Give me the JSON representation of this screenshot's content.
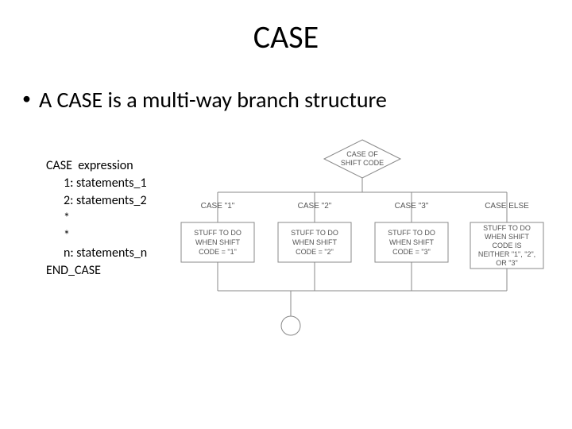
{
  "title": "CASE",
  "bullet": "A CASE is a multi-way branch structure",
  "code": {
    "l1": "CASE  expression",
    "l2": "1: statements_1",
    "l3": "2: statements_2",
    "l4": "*",
    "l5": "*",
    "l6": "n: statements_n",
    "l7": "END_CASE"
  },
  "diagram": {
    "decision": {
      "line1": "CASE OF",
      "line2": "SHIFT CODE"
    },
    "branches": {
      "b1": "CASE \"1\"",
      "b2": "CASE \"2\"",
      "b3": "CASE \"3\"",
      "b4": "CASE ELSE"
    },
    "boxes": {
      "bx1": {
        "l1": "STUFF TO DO",
        "l2": "WHEN SHIFT",
        "l3": "CODE = \"1\""
      },
      "bx2": {
        "l1": "STUFF TO DO",
        "l2": "WHEN SHIFT",
        "l3": "CODE = \"2\""
      },
      "bx3": {
        "l1": "STUFF TO DO",
        "l2": "WHEN SHIFT",
        "l3": "CODE = \"3\""
      },
      "bx4": {
        "l1": "STUFF TO DO",
        "l2": "WHEN SHIFT",
        "l3": "CODE IS",
        "l4": "NEITHER \"1\", \"2\",",
        "l5": "OR \"3\""
      }
    }
  }
}
